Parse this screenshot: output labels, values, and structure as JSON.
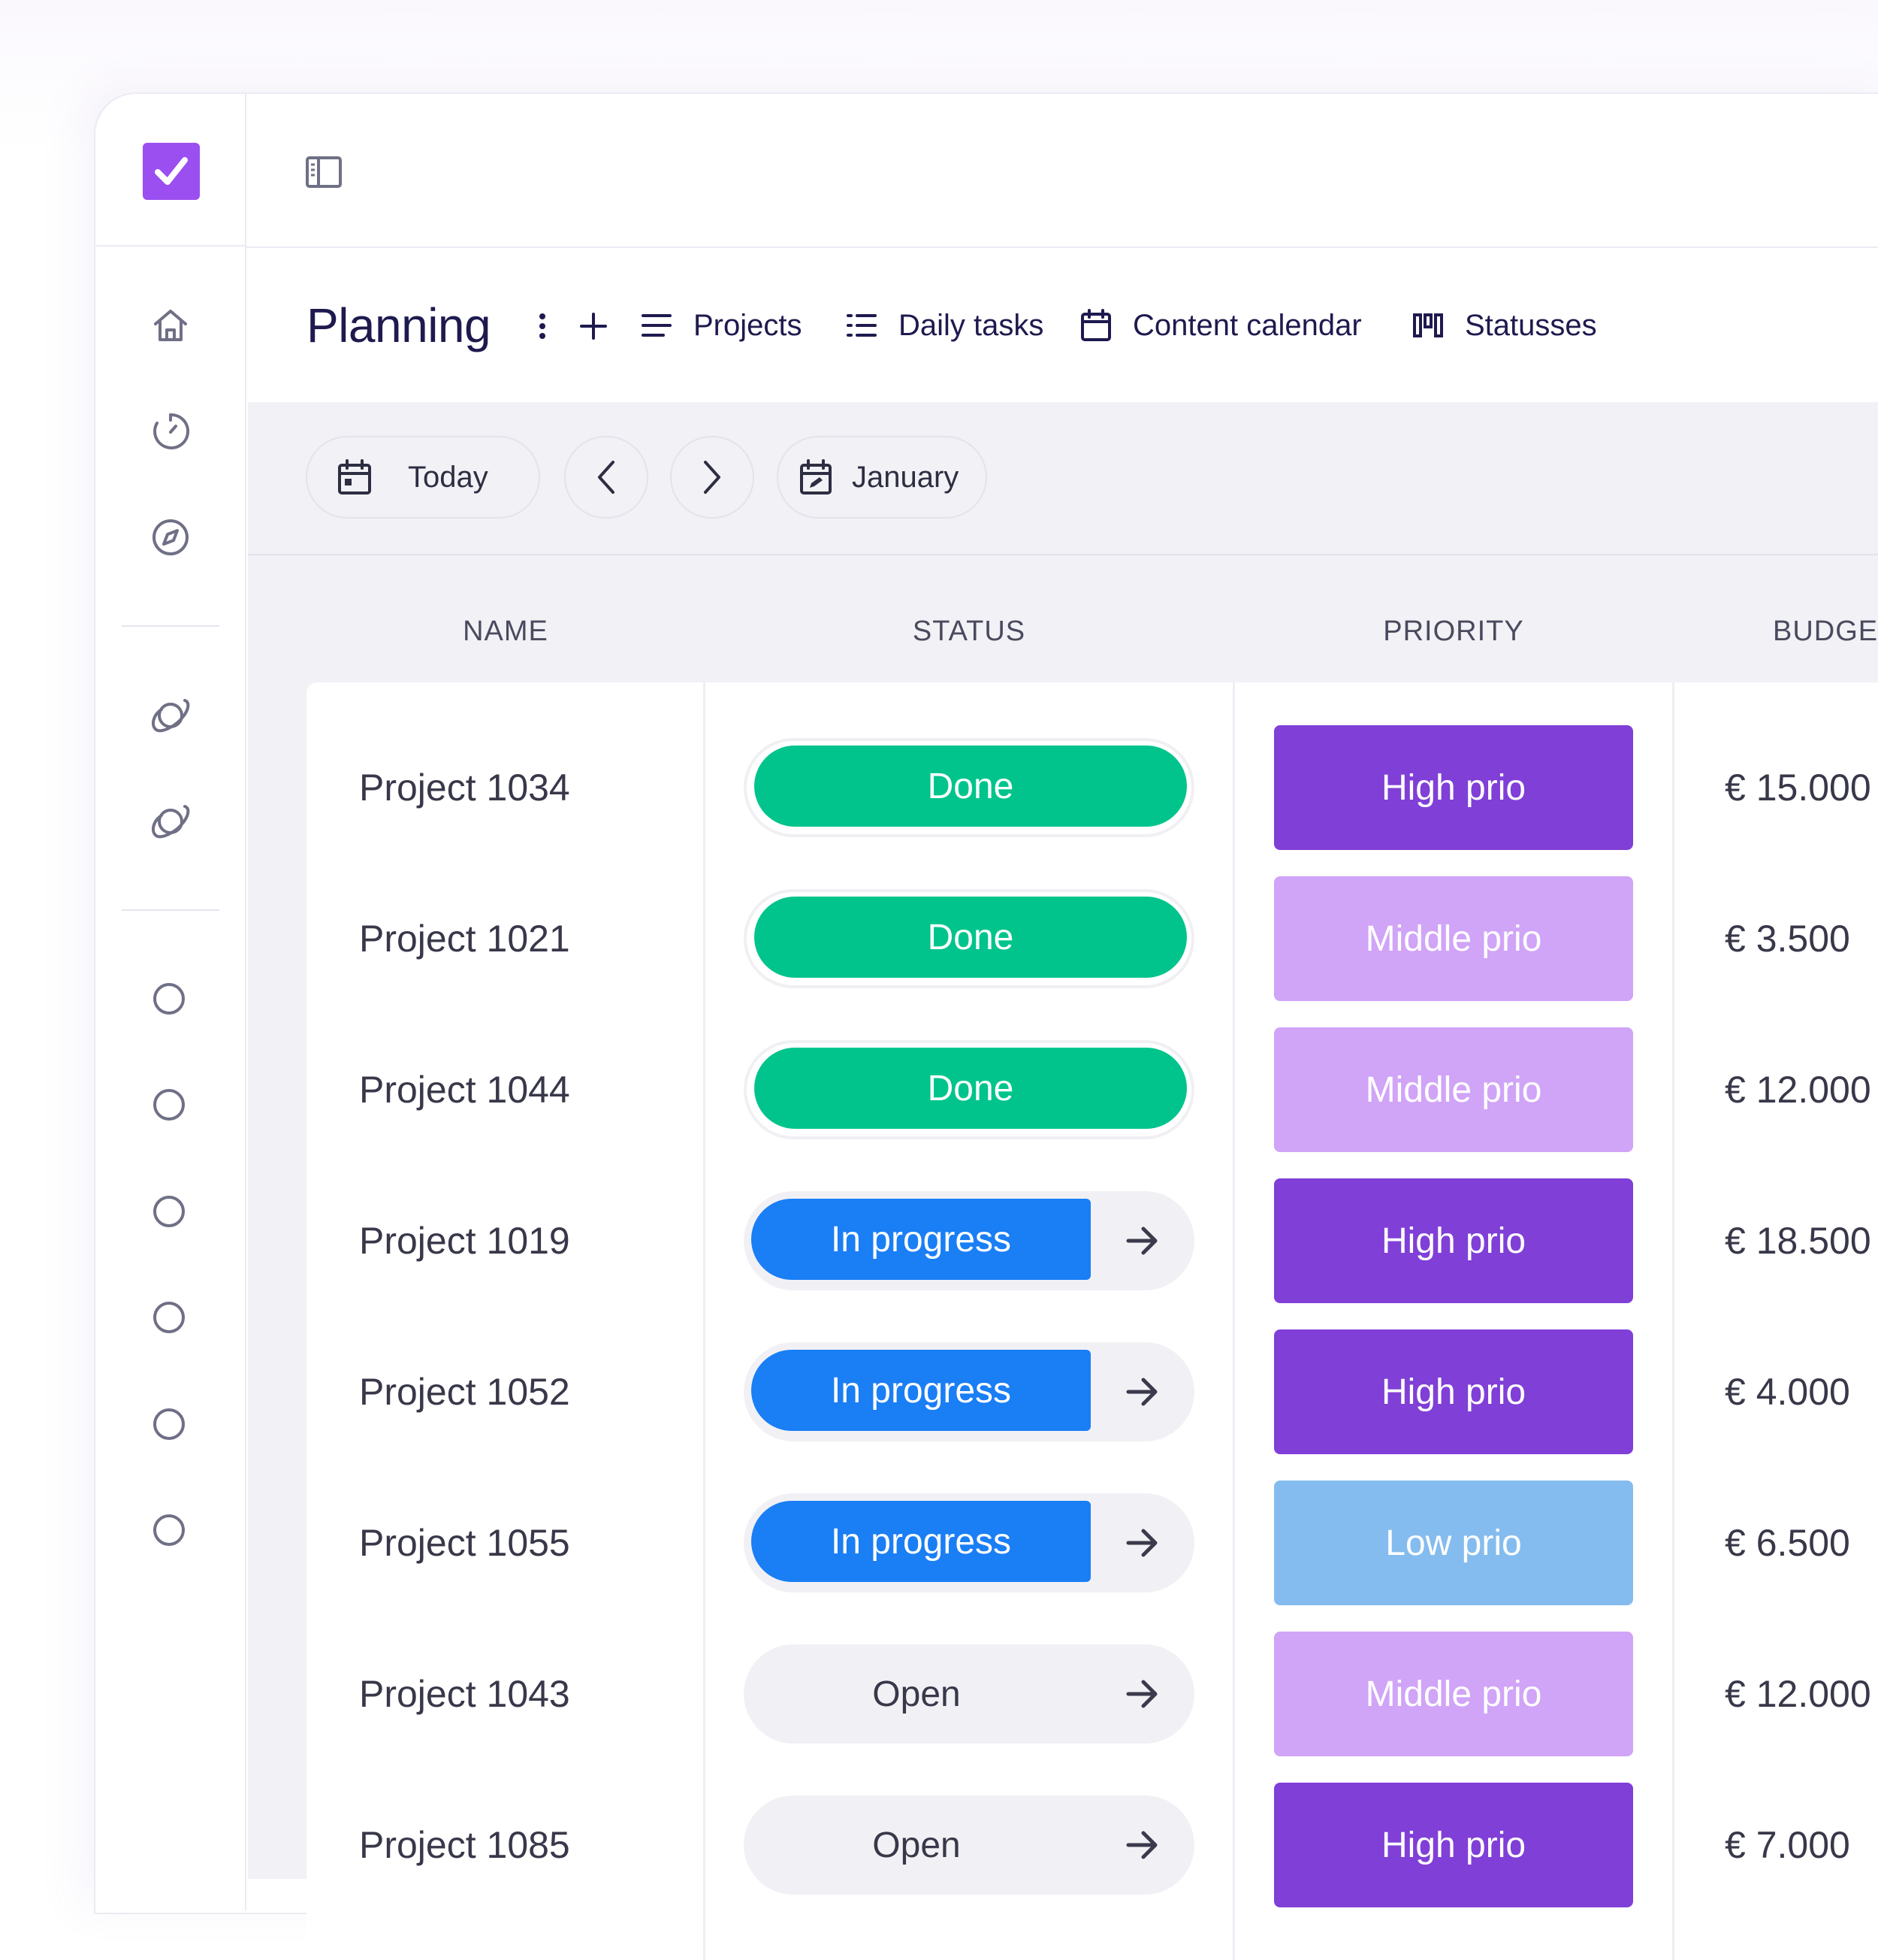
{
  "page": {
    "title": "Planning"
  },
  "header": {
    "tabs": [
      {
        "label": "Projects",
        "icon": "list-icon"
      },
      {
        "label": "Daily tasks",
        "icon": "bullet-list-icon"
      },
      {
        "label": "Content calendar",
        "icon": "calendar-icon"
      },
      {
        "label": "Statusses",
        "icon": "kanban-icon"
      }
    ]
  },
  "toolbar": {
    "today_label": "Today",
    "month_label": "January"
  },
  "table": {
    "columns": [
      "NAME",
      "STATUS",
      "PRIORITY",
      "BUDGE"
    ],
    "rows": [
      {
        "name": "Project 1034",
        "status": "Done",
        "priority": "High prio",
        "budget": "€ 15.000"
      },
      {
        "name": "Project 1021",
        "status": "Done",
        "priority": "Middle prio",
        "budget": "€ 3.500"
      },
      {
        "name": "Project 1044",
        "status": "Done",
        "priority": "Middle prio",
        "budget": "€ 12.000"
      },
      {
        "name": "Project 1019",
        "status": "In progress",
        "priority": "High prio",
        "budget": "€ 18.500"
      },
      {
        "name": "Project 1052",
        "status": "In progress",
        "priority": "High prio",
        "budget": "€ 4.000"
      },
      {
        "name": "Project 1055",
        "status": "In progress",
        "priority": "Low prio",
        "budget": "€ 6.500"
      },
      {
        "name": "Project 1043",
        "status": "Open",
        "priority": "Middle prio",
        "budget": "€ 12.000"
      },
      {
        "name": "Project 1085",
        "status": "Open",
        "priority": "High prio",
        "budget": "€ 7.000"
      }
    ]
  },
  "colors": {
    "brand": "#9b4ff0",
    "done": "#00c48c",
    "in_progress": "#1a7ef5",
    "high_prio": "#803fd7",
    "middle_prio": "#d0a4f7",
    "low_prio": "#85bcef"
  }
}
